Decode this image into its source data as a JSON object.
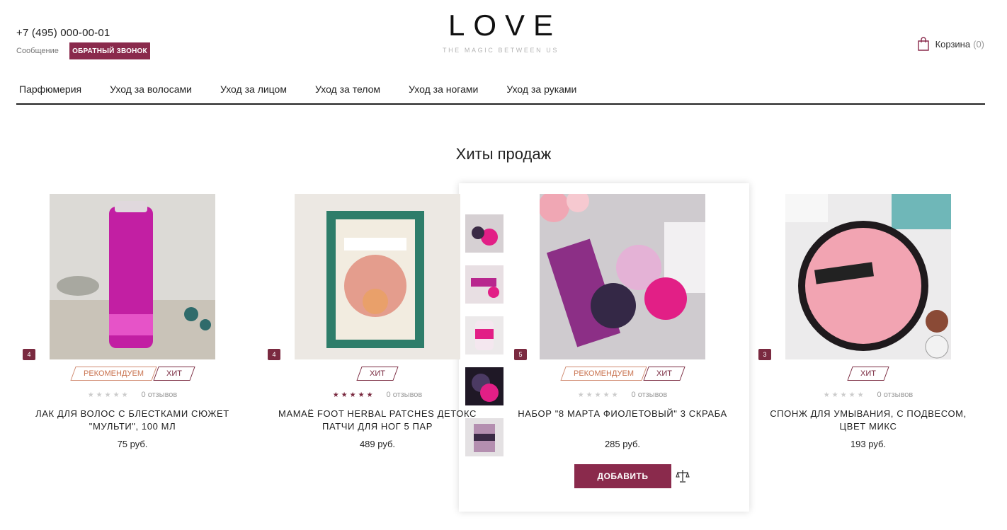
{
  "header": {
    "phone": "+7 (495) 000-00-01",
    "message_label": "Сообщение",
    "callback_label": "ОБРАТНЫЙ ЗВОНОК",
    "logo_text": "LOVE",
    "logo_tagline": "THE MAGIC BETWEEN US",
    "cart_label": "Корзина",
    "cart_count": "(0)"
  },
  "nav": [
    "Парфюмерия",
    "Уход за волосами",
    "Уход за лицом",
    "Уход за телом",
    "Уход за ногами",
    "Уход за руками"
  ],
  "section_title": "Хиты продаж",
  "label_recommend": "РЕКОМЕНДУЕМ",
  "label_hit": "ХИТ",
  "products": [
    {
      "photos": "4",
      "name": "ЛАК ДЛЯ ВОЛОС С БЛЕСТКАМИ СЮЖЕТ \"МУЛЬТИ\", 100 МЛ",
      "price": "75 руб.",
      "reviews": "0 отзывов",
      "stars": "★★★★★"
    },
    {
      "photos": "4",
      "name": "МАМАЁ FOOT HERBAL PATCHES ДЕТОКС ПАТЧИ ДЛЯ НОГ 5 ПАР",
      "price": "489 руб.",
      "reviews": "0 отзывов",
      "stars": "★★★★★"
    },
    {
      "photos": "5",
      "name": "НАБОР \"8 МАРТА ФИОЛЕТОВЫЙ\" 3 СКРАБА",
      "price": "285 руб.",
      "reviews": "0 отзывов",
      "stars": "★★★★★"
    },
    {
      "photos": "3",
      "name": "СПОНЖ ДЛЯ УМЫВАНИЯ, С ПОДВЕСОМ, ЦВЕТ МИКС",
      "price": "193 руб.",
      "reviews": "0 отзывов",
      "stars": "★★★★★"
    }
  ],
  "add_button": "ДОБАВИТЬ",
  "colors": {
    "accent": "#8a2a4c",
    "recommend": "#c9734f"
  }
}
